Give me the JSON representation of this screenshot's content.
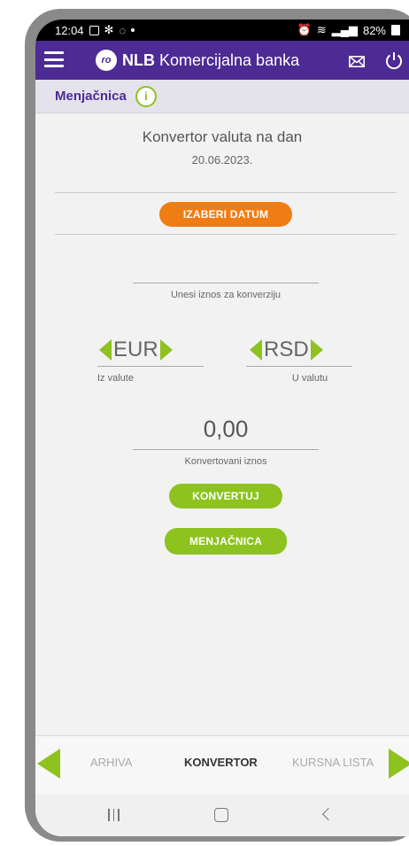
{
  "status_bar": {
    "time": "12:04",
    "battery": "82%"
  },
  "app_bar": {
    "brand_bold": "NLB",
    "brand_rest": "Komercijalna banka",
    "logo_text": "ro"
  },
  "subheader": {
    "title": "Menjačnica",
    "info_glyph": "i"
  },
  "converter": {
    "title": "Konvertor valuta na dan",
    "date": "20.06.2023.",
    "choose_date_label": "IZABERI DATUM",
    "amount_input_placeholder": "",
    "amount_hint": "Unesi iznos za konverziju",
    "from_currency": "EUR",
    "from_label": "Iz valute",
    "to_currency": "RSD",
    "to_label": "U valutu",
    "converted_amount": "0,00",
    "converted_label": "Konvertovani iznos",
    "convert_label": "KONVERTUJ",
    "exchange_label": "MENJAČNICA"
  },
  "bottom_tabs": [
    {
      "label": "ARHIVA",
      "active": false
    },
    {
      "label": "KONVERTOR",
      "active": true
    },
    {
      "label": "KURSNA LISTA",
      "active": false
    }
  ],
  "colors": {
    "primary": "#4d2a94",
    "accent_green": "#8dc21f",
    "accent_orange": "#f07d14"
  }
}
